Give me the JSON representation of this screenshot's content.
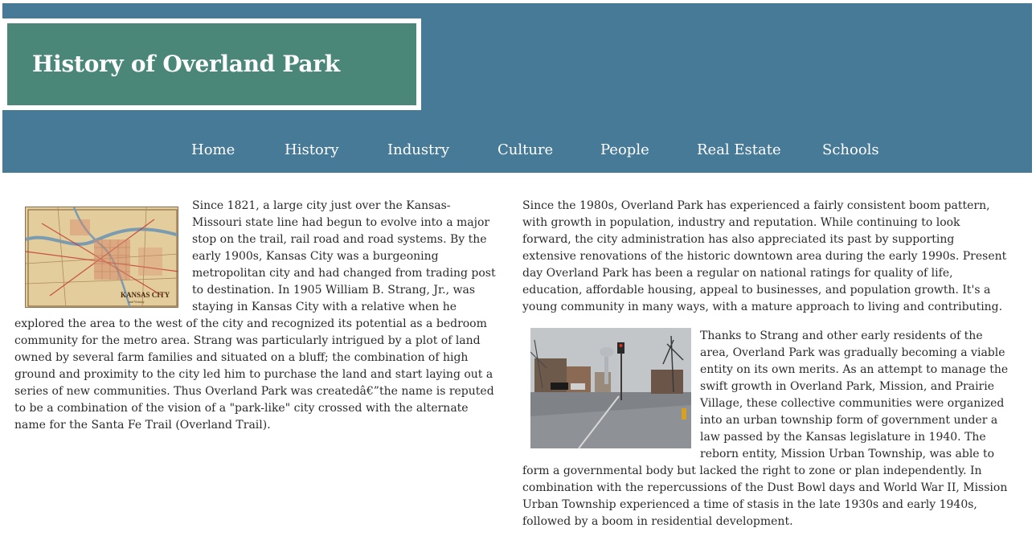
{
  "header": {
    "title": "History of Overland Park",
    "nav": [
      "Home",
      "History",
      "Industry",
      "Culture",
      "People",
      "Real Estate",
      "Schools"
    ]
  },
  "images": {
    "map_label": "KANSAS CITY",
    "map_sublabel": "and Vicinity"
  },
  "left": {
    "paragraph": "Since 1821, a large city just over the Kansas-Missouri state line had begun to evolve into a major stop on the trail, rail road and road systems. By the early 1900s, Kansas City was a burgeoning metropolitan city and had changed from trading post to destination. In 1905 William B. Strang, Jr., was staying in Kansas City with a relative when he explored the area to the west of the city and recognized its potential as a bedroom community for the metro area. Strang was particularly intrigued by a plot of land owned by several farm families and situated on a bluff; the combination of high ground and proximity to the city led him to purchase the land and start laying out a series of new communities. Thus Overland Park was createdâ€”the name is reputed to be a combination of the vision of a \"park-like\" city crossed with the alternate name for the Santa Fe Trail (Overland Trail)."
  },
  "right": {
    "paragraph1": "Since the 1980s, Overland Park has experienced a fairly consistent boom pattern, with growth in population, industry and reputation. While continuing to look forward, the city administration has also appreciated its past by supporting extensive renovations of the historic downtown area during the early 1990s. Present day Overland Park has been a regular on national ratings for quality of life, education, affordable housing, appeal to businesses, and population growth. It's a young community in many ways, with a mature approach to living and contributing.",
    "paragraph2": "Thanks to Strang and other early residents of the area, Overland Park was gradually becoming a viable entity on its own merits. As an attempt to manage the swift growth in Overland Park, Mission, and Prairie Village, these collective communities were organized into an urban township form of government under a law passed by the Kansas legislature in 1940. The reborn entity, Mission Urban Township, was able to form a governmental body but lacked the right to zone or plan independently. In combination with the repercussions of the Dust Bowl days and World War II, Mission Urban Township experienced a time of stasis in the late 1930s and early 1940s, followed by a boom in residential development."
  }
}
